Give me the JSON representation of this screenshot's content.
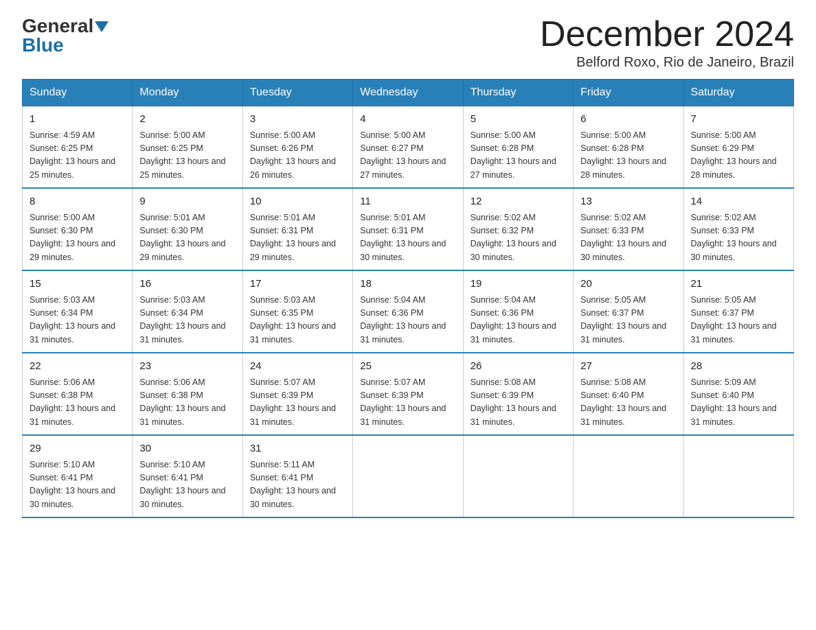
{
  "logo": {
    "general": "General",
    "blue": "Blue"
  },
  "title": "December 2024",
  "location": "Belford Roxo, Rio de Janeiro, Brazil",
  "days_of_week": [
    "Sunday",
    "Monday",
    "Tuesday",
    "Wednesday",
    "Thursday",
    "Friday",
    "Saturday"
  ],
  "weeks": [
    [
      {
        "day": "1",
        "sunrise": "4:59 AM",
        "sunset": "6:25 PM",
        "daylight": "13 hours and 25 minutes."
      },
      {
        "day": "2",
        "sunrise": "5:00 AM",
        "sunset": "6:25 PM",
        "daylight": "13 hours and 25 minutes."
      },
      {
        "day": "3",
        "sunrise": "5:00 AM",
        "sunset": "6:26 PM",
        "daylight": "13 hours and 26 minutes."
      },
      {
        "day": "4",
        "sunrise": "5:00 AM",
        "sunset": "6:27 PM",
        "daylight": "13 hours and 27 minutes."
      },
      {
        "day": "5",
        "sunrise": "5:00 AM",
        "sunset": "6:28 PM",
        "daylight": "13 hours and 27 minutes."
      },
      {
        "day": "6",
        "sunrise": "5:00 AM",
        "sunset": "6:28 PM",
        "daylight": "13 hours and 28 minutes."
      },
      {
        "day": "7",
        "sunrise": "5:00 AM",
        "sunset": "6:29 PM",
        "daylight": "13 hours and 28 minutes."
      }
    ],
    [
      {
        "day": "8",
        "sunrise": "5:00 AM",
        "sunset": "6:30 PM",
        "daylight": "13 hours and 29 minutes."
      },
      {
        "day": "9",
        "sunrise": "5:01 AM",
        "sunset": "6:30 PM",
        "daylight": "13 hours and 29 minutes."
      },
      {
        "day": "10",
        "sunrise": "5:01 AM",
        "sunset": "6:31 PM",
        "daylight": "13 hours and 29 minutes."
      },
      {
        "day": "11",
        "sunrise": "5:01 AM",
        "sunset": "6:31 PM",
        "daylight": "13 hours and 30 minutes."
      },
      {
        "day": "12",
        "sunrise": "5:02 AM",
        "sunset": "6:32 PM",
        "daylight": "13 hours and 30 minutes."
      },
      {
        "day": "13",
        "sunrise": "5:02 AM",
        "sunset": "6:33 PM",
        "daylight": "13 hours and 30 minutes."
      },
      {
        "day": "14",
        "sunrise": "5:02 AM",
        "sunset": "6:33 PM",
        "daylight": "13 hours and 30 minutes."
      }
    ],
    [
      {
        "day": "15",
        "sunrise": "5:03 AM",
        "sunset": "6:34 PM",
        "daylight": "13 hours and 31 minutes."
      },
      {
        "day": "16",
        "sunrise": "5:03 AM",
        "sunset": "6:34 PM",
        "daylight": "13 hours and 31 minutes."
      },
      {
        "day": "17",
        "sunrise": "5:03 AM",
        "sunset": "6:35 PM",
        "daylight": "13 hours and 31 minutes."
      },
      {
        "day": "18",
        "sunrise": "5:04 AM",
        "sunset": "6:36 PM",
        "daylight": "13 hours and 31 minutes."
      },
      {
        "day": "19",
        "sunrise": "5:04 AM",
        "sunset": "6:36 PM",
        "daylight": "13 hours and 31 minutes."
      },
      {
        "day": "20",
        "sunrise": "5:05 AM",
        "sunset": "6:37 PM",
        "daylight": "13 hours and 31 minutes."
      },
      {
        "day": "21",
        "sunrise": "5:05 AM",
        "sunset": "6:37 PM",
        "daylight": "13 hours and 31 minutes."
      }
    ],
    [
      {
        "day": "22",
        "sunrise": "5:06 AM",
        "sunset": "6:38 PM",
        "daylight": "13 hours and 31 minutes."
      },
      {
        "day": "23",
        "sunrise": "5:06 AM",
        "sunset": "6:38 PM",
        "daylight": "13 hours and 31 minutes."
      },
      {
        "day": "24",
        "sunrise": "5:07 AM",
        "sunset": "6:39 PM",
        "daylight": "13 hours and 31 minutes."
      },
      {
        "day": "25",
        "sunrise": "5:07 AM",
        "sunset": "6:39 PM",
        "daylight": "13 hours and 31 minutes."
      },
      {
        "day": "26",
        "sunrise": "5:08 AM",
        "sunset": "6:39 PM",
        "daylight": "13 hours and 31 minutes."
      },
      {
        "day": "27",
        "sunrise": "5:08 AM",
        "sunset": "6:40 PM",
        "daylight": "13 hours and 31 minutes."
      },
      {
        "day": "28",
        "sunrise": "5:09 AM",
        "sunset": "6:40 PM",
        "daylight": "13 hours and 31 minutes."
      }
    ],
    [
      {
        "day": "29",
        "sunrise": "5:10 AM",
        "sunset": "6:41 PM",
        "daylight": "13 hours and 30 minutes."
      },
      {
        "day": "30",
        "sunrise": "5:10 AM",
        "sunset": "6:41 PM",
        "daylight": "13 hours and 30 minutes."
      },
      {
        "day": "31",
        "sunrise": "5:11 AM",
        "sunset": "6:41 PM",
        "daylight": "13 hours and 30 minutes."
      },
      null,
      null,
      null,
      null
    ]
  ]
}
